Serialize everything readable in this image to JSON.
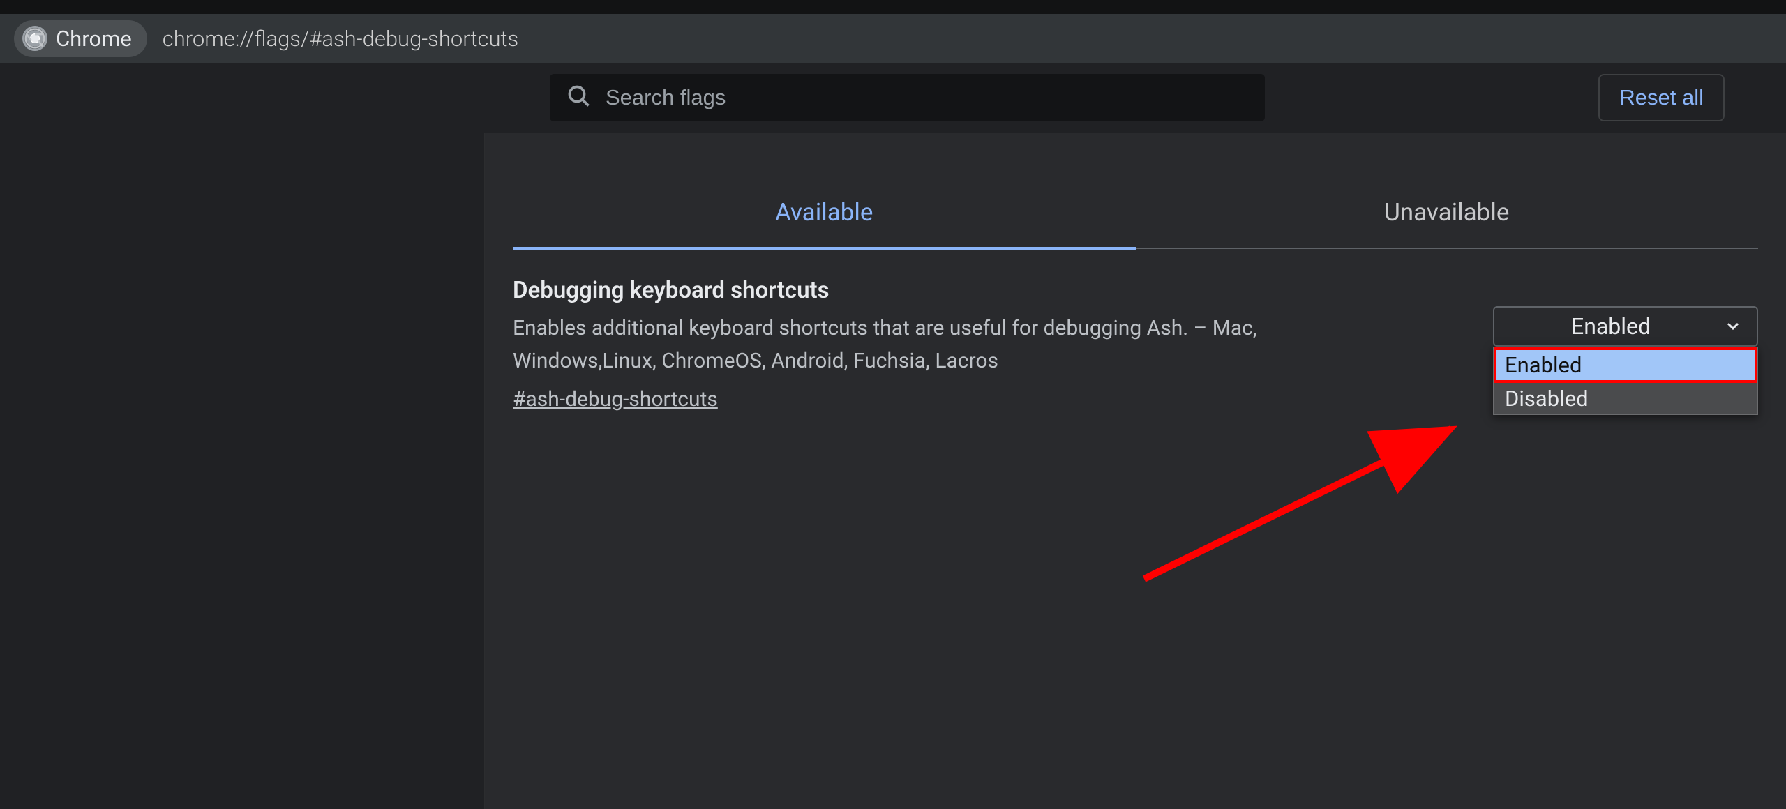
{
  "browser": {
    "name": "Chrome",
    "url": "chrome://flags/#ash-debug-shortcuts"
  },
  "header": {
    "search_placeholder": "Search flags",
    "reset_label": "Reset all"
  },
  "tabs": {
    "available": "Available",
    "unavailable": "Unavailable"
  },
  "flag": {
    "title": "Debugging keyboard shortcuts",
    "description": "Enables additional keyboard shortcuts that are useful for debugging Ash. – Mac, Windows,Linux, ChromeOS, Android, Fuchsia, Lacros",
    "hash": "#ash-debug-shortcuts",
    "selected": "Enabled",
    "options": [
      "Enabled",
      "Disabled"
    ]
  }
}
